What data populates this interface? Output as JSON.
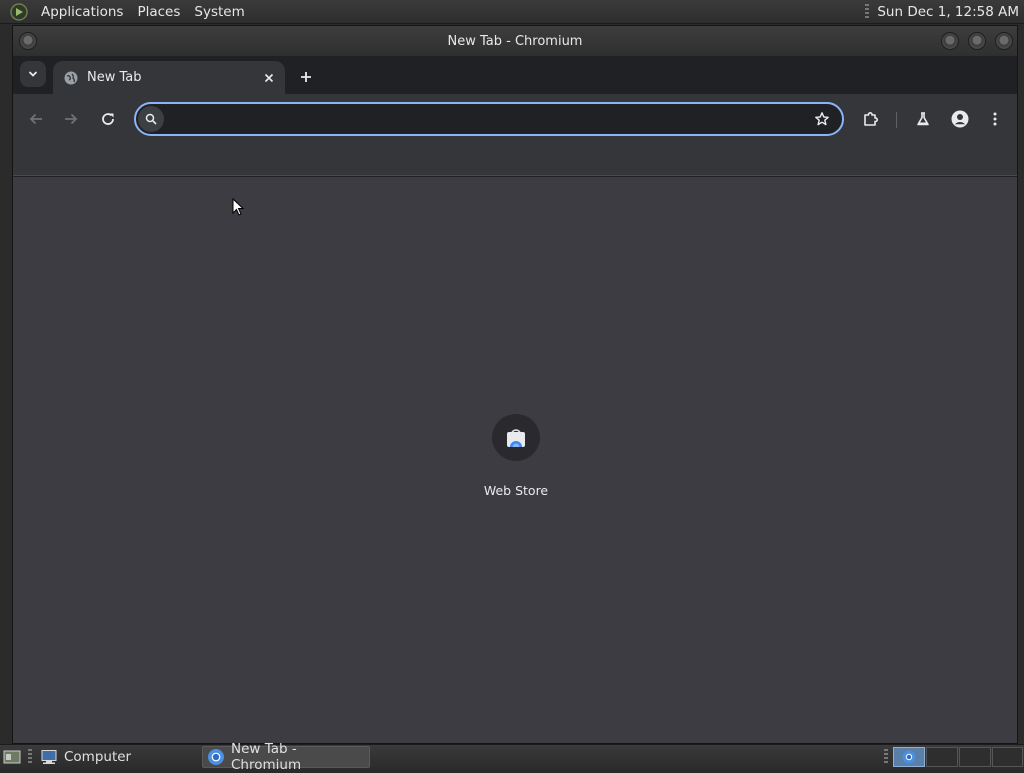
{
  "top_panel": {
    "menus": [
      "Applications",
      "Places",
      "System"
    ],
    "clock": "Sun Dec  1, 12:58 AM"
  },
  "window": {
    "title": "New Tab - Chromium"
  },
  "tabs": [
    {
      "label": "New Tab",
      "favicon": "globe-icon",
      "active": true
    }
  ],
  "omnibox": {
    "value": "",
    "placeholder": ""
  },
  "shortcuts": [
    {
      "label": "Web Store",
      "icon": "web-store-icon"
    }
  ],
  "taskbar": {
    "tasks": [
      {
        "label": "Computer",
        "icon": "computer-icon",
        "active": false
      },
      {
        "label": "New Tab - Chromium",
        "icon": "chromium-icon",
        "active": true
      }
    ]
  },
  "colors": {
    "accent": "#8ab4f8",
    "toolbar": "#35363a",
    "page_background": "#3c3c42"
  }
}
